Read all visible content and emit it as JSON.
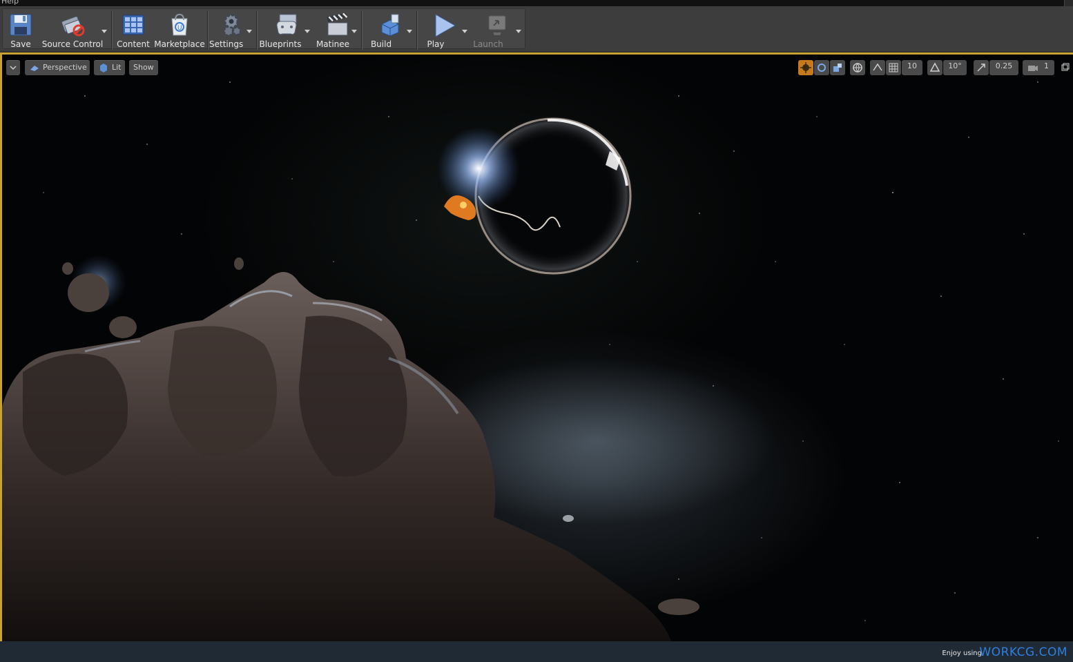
{
  "menubar": {
    "help_label": "Help"
  },
  "toolbar": {
    "save": "Save",
    "source_control": "Source Control",
    "content": "Content",
    "marketplace": "Marketplace",
    "settings": "Settings",
    "blueprints": "Blueprints",
    "matinee": "Matinee",
    "build": "Build",
    "play": "Play",
    "launch": "Launch"
  },
  "viewport": {
    "view_mode": "Perspective",
    "lighting_mode": "Lit",
    "show_label": "Show",
    "grid_snap": "10",
    "rotation_snap": "10°",
    "scale_snap": "0.25",
    "camera_speed": "1"
  },
  "statusbar": {
    "enjoy_text": "Enjoy using",
    "brand_text": "WORKCG.COM"
  },
  "colors": {
    "accent_orange": "#c57a1e",
    "viewport_border": "#c8a233",
    "brand_blue": "#2f7fe0"
  }
}
